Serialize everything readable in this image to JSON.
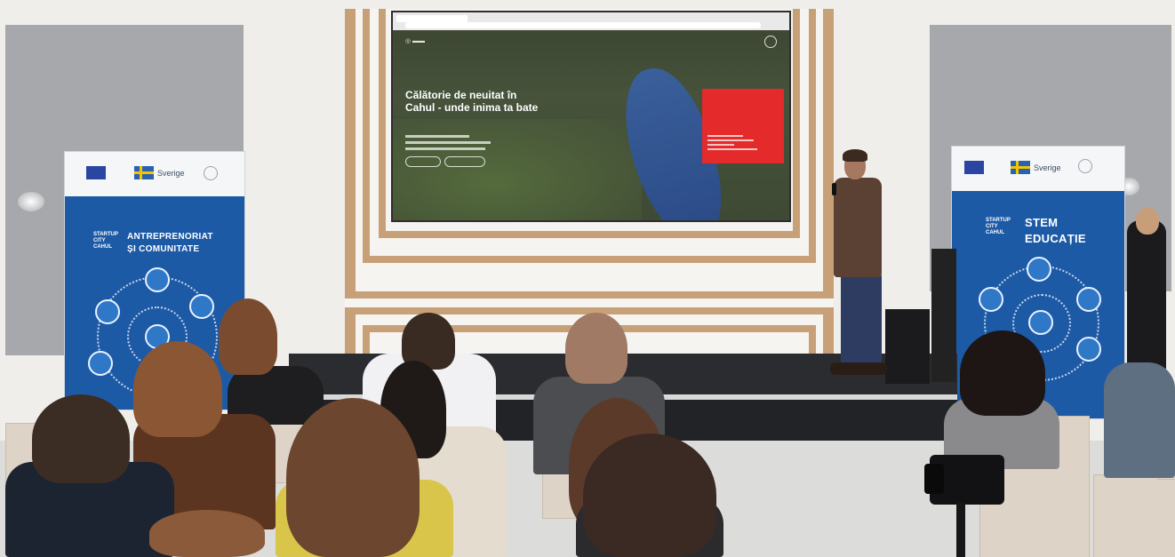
{
  "screen": {
    "hero_title": "Călătorie de neuitat în Cahul - unde inima ta bate"
  },
  "banner_left": {
    "sverige_label": "Sverige",
    "logo_text": "STARTUP CITY CAHUL",
    "title_line1": "ANTREPRENORIAT",
    "title_line2": "ȘI COMUNITATE"
  },
  "banner_right": {
    "sverige_label": "Sverige",
    "logo_text": "STARTUP CITY CAHUL",
    "title_line1": "STEM",
    "title_line2": "EDUCAȚIE"
  },
  "colors": {
    "banner_blue": "#1d5aa6",
    "frame_wood": "#c8a077",
    "screen_red_card": "#e42a2a",
    "wall_grey": "#a6a8ab"
  }
}
